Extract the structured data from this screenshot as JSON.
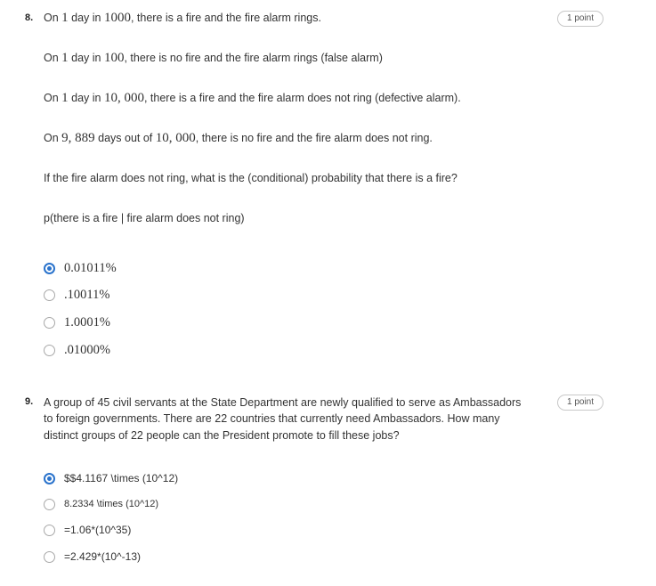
{
  "q8": {
    "number": "8.",
    "points": "1 point",
    "line1": {
      "pre": "On ",
      "m1": "1",
      "mid": " day in ",
      "m2": "1000",
      "post": ", there is a fire and the fire alarm rings."
    },
    "line2": {
      "pre": "On ",
      "m1": "1",
      "mid": " day in ",
      "m2": "100",
      "post": ", there is no fire and the fire alarm rings (false alarm)"
    },
    "line3": {
      "pre": "On ",
      "m1": "1",
      "mid": " day in ",
      "m2": "10, 000",
      "post": ", there is a fire and the fire alarm does not ring (defective alarm)."
    },
    "line4": {
      "pre": "On ",
      "m1": "9, 889",
      "mid": " days out of ",
      "m2": "10, 000",
      "post": ", there is no fire and the fire alarm does not ring."
    },
    "question": "If the fire alarm does not ring, what is the (conditional) probability that there is a fire?",
    "expression": "p(there is a fire | fire alarm does not ring)",
    "options": [
      {
        "label": "0.01011%",
        "selected": true
      },
      {
        "label": ".10011%",
        "selected": false
      },
      {
        "label": "1.0001%",
        "selected": false
      },
      {
        "label": ".01000%",
        "selected": false
      }
    ]
  },
  "q9": {
    "number": "9.",
    "points": "1 point",
    "text": "A group of 45 civil servants at the State Department are newly qualified to serve as Ambassadors to foreign governments. There are 22 countries that currently need Ambassadors. How many distinct groups of 22 people can the President promote to fill these jobs?",
    "options": [
      {
        "label": "$$4.1167 \\times (10^12)",
        "selected": true
      },
      {
        "label": "8.2334 \\times (10^12)",
        "selected": false
      },
      {
        "label": "=1.06*(10^35)",
        "selected": false
      },
      {
        "label": "=2.429*(10^-13)",
        "selected": false
      }
    ]
  }
}
